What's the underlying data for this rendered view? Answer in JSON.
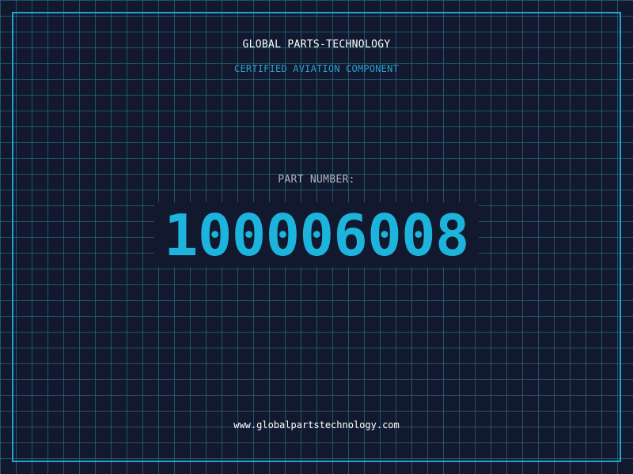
{
  "header": {
    "company": "GLOBAL PARTS-TECHNOLOGY",
    "subtitle": "CERTIFIED AVIATION COMPONENT"
  },
  "part": {
    "label": "PART NUMBER:",
    "number": "100006008"
  },
  "footer": {
    "url": "www.globalpartstechnology.com"
  },
  "colors": {
    "background": "#12192e",
    "grid": "#266682",
    "frame": "#1fa4d4",
    "accent": "#1cb4dc",
    "label": "#aab4c4",
    "text": "#ffffff"
  }
}
